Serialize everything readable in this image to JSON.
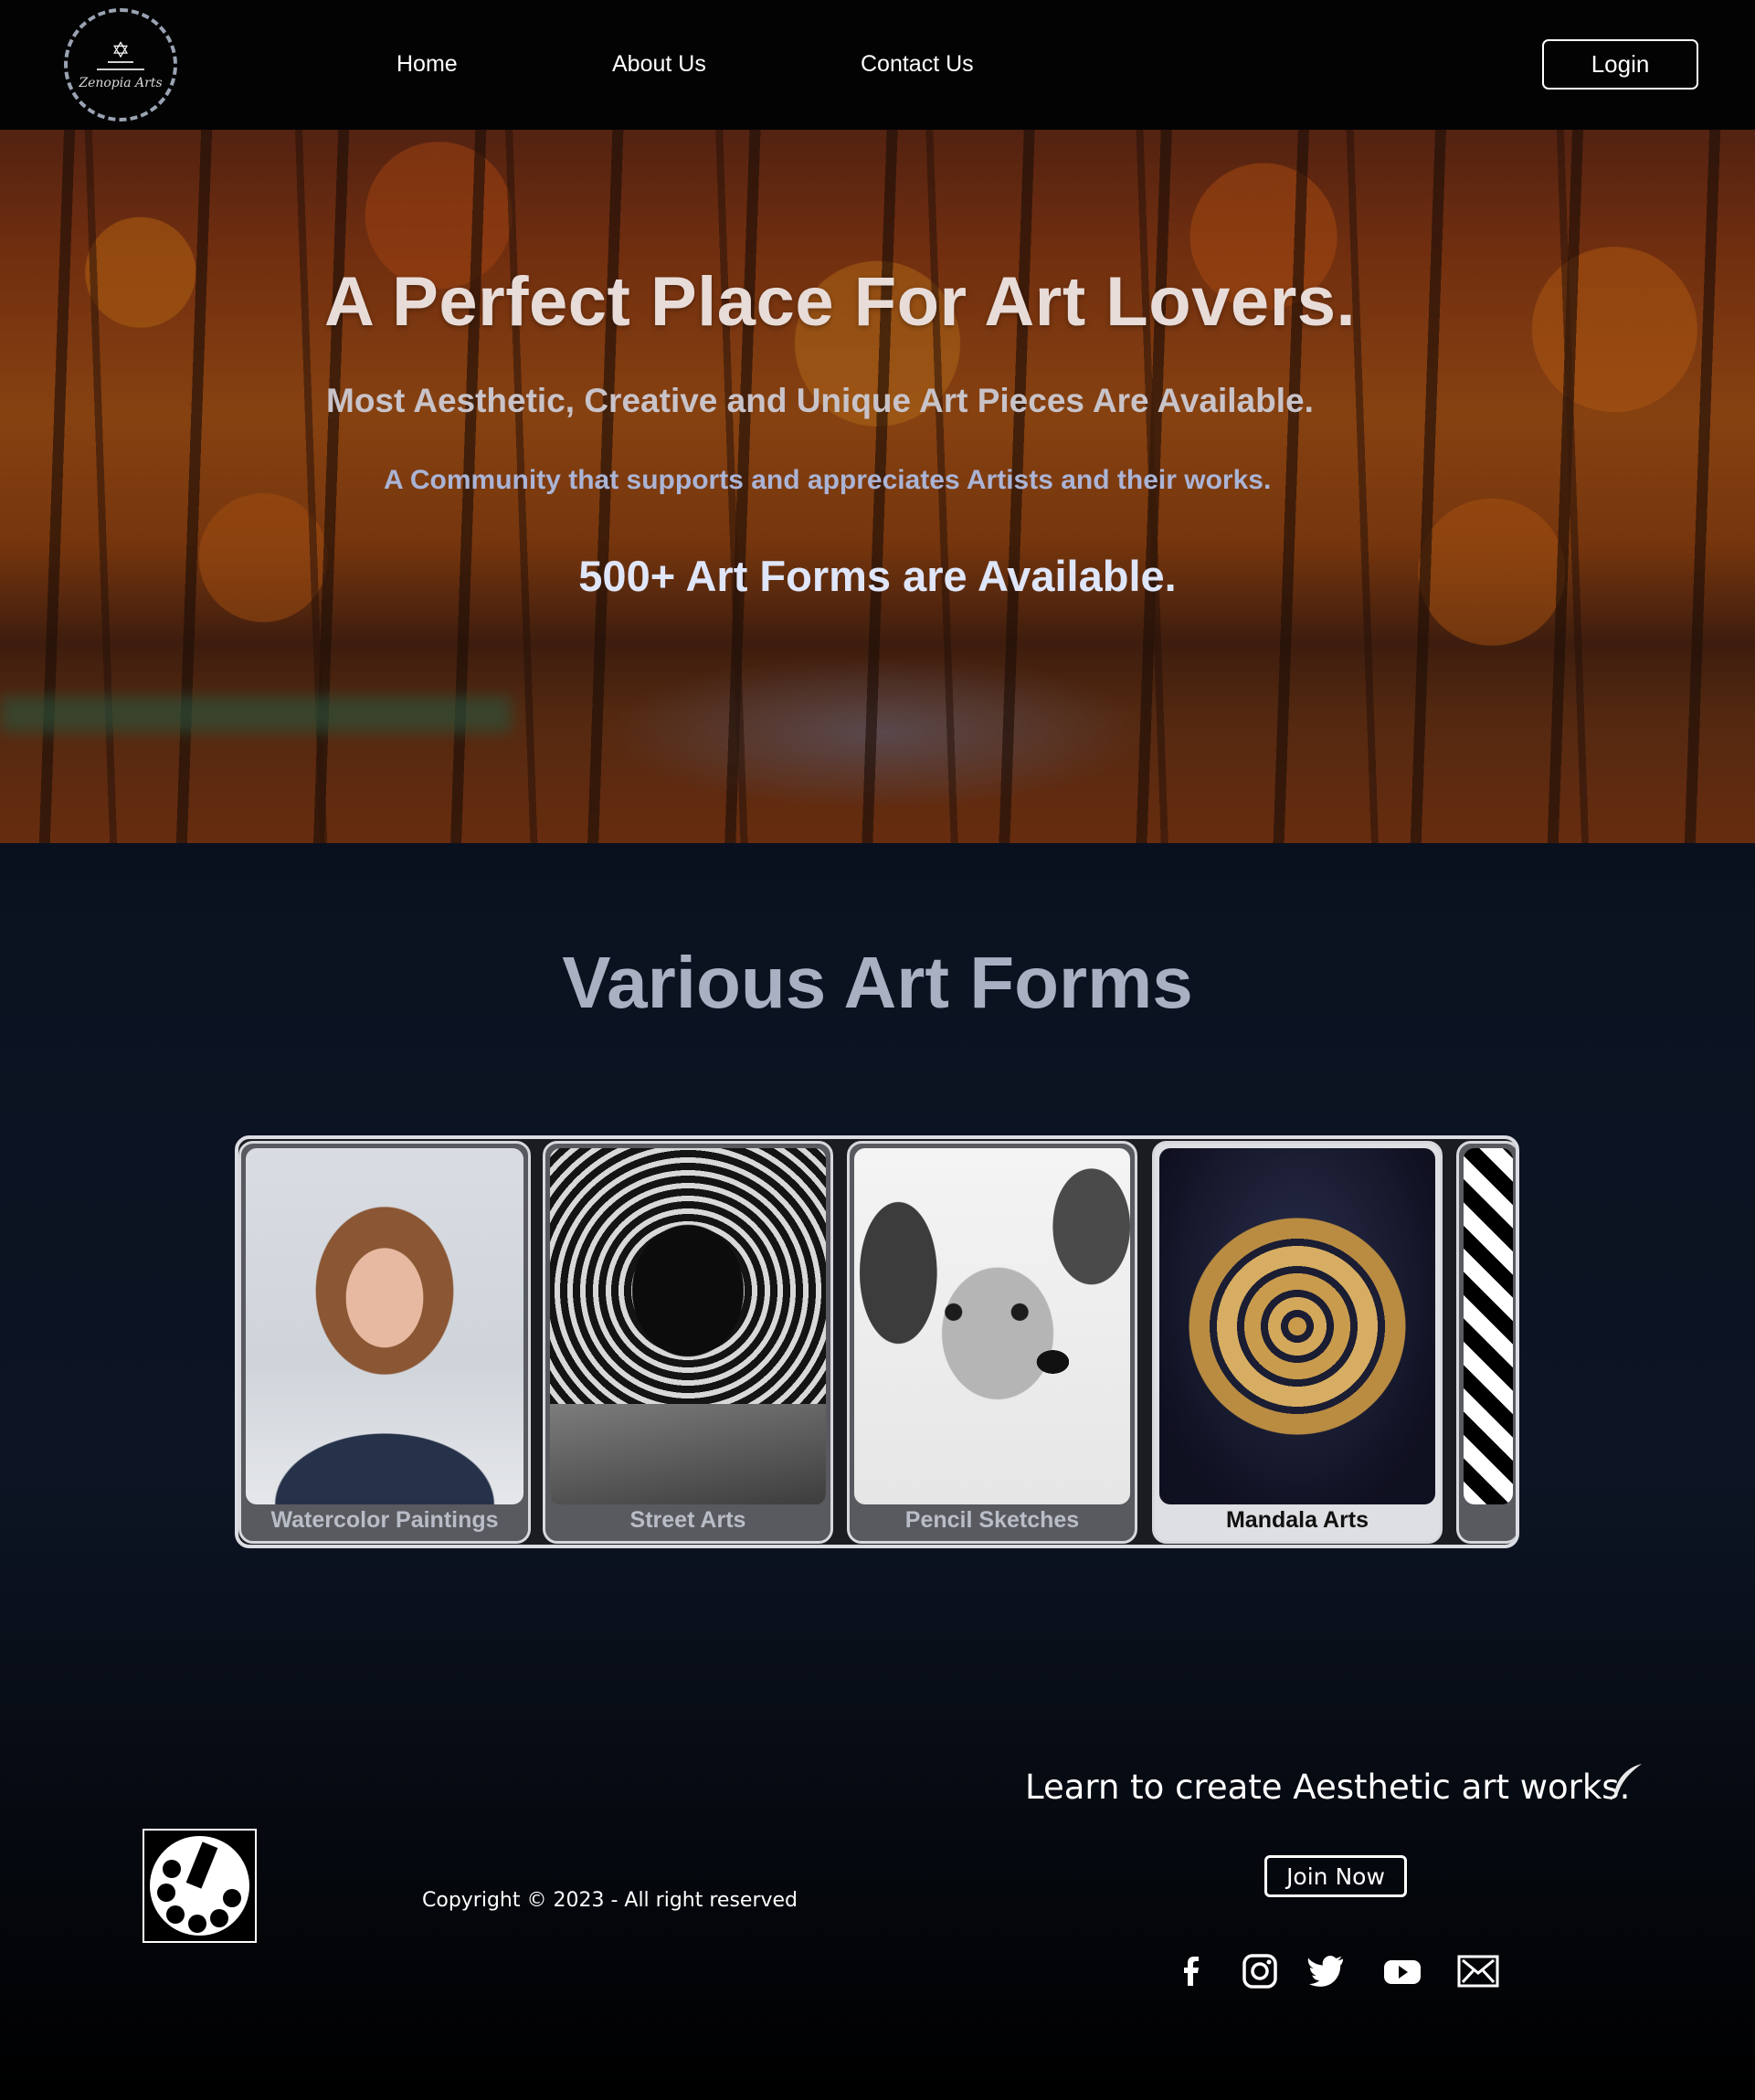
{
  "nav": {
    "logo_text": "Zenopia Arts",
    "links": [
      "Home",
      "About Us",
      "Contact Us"
    ],
    "login_label": "Login"
  },
  "hero": {
    "title": "A Perfect Place For Art Lovers.",
    "subtitle": "Most Aesthetic, Creative and Unique Art Pieces Are Available.",
    "tagline": "A Community that supports and appreciates Artists and their works.",
    "highlight": "500+ Art Forms are Available."
  },
  "section": {
    "title": "Various Art Forms",
    "cards": [
      {
        "label": "Watercolor Paintings",
        "image": "watercolor-girl-portrait"
      },
      {
        "label": "Street Arts",
        "image": "street-art-tiger-mural"
      },
      {
        "label": "Pencil Sketches",
        "image": "pencil-sketch-puppy"
      },
      {
        "label": "Mandala Arts",
        "image": "gold-mandala"
      },
      {
        "label": "",
        "image": "op-art-checker"
      }
    ]
  },
  "footer": {
    "copyright": "Copyright © 2023 - All right reserved",
    "learn_text": "Learn to create Aesthetic art works.",
    "join_label": "Join Now",
    "social_icons": [
      "facebook-icon",
      "instagram-icon",
      "twitter-icon",
      "youtube-icon",
      "mail-icon"
    ]
  }
}
